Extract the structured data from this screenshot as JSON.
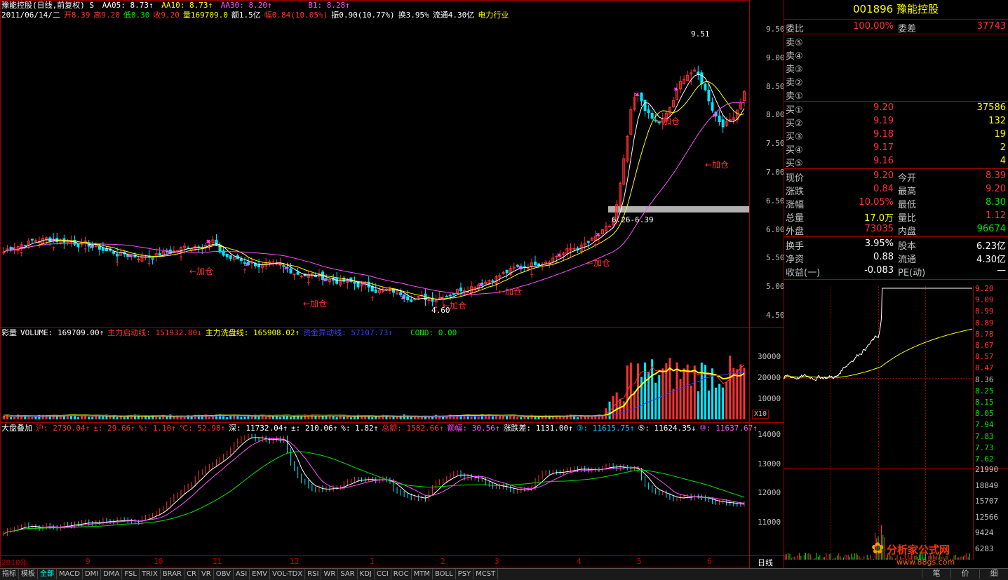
{
  "stock": {
    "code": "001896",
    "name": "豫能控股"
  },
  "top": {
    "line1": [
      "豫能控股(日线,前复权) S",
      "AA05: 8.73↑",
      "AA10: 8.73↑",
      "AA30: 8.20↑",
      "B1: 8.28↑"
    ],
    "line2_date": "2011/06/14/二",
    "line2_open": "开8.39",
    "line2_high": "高9.20",
    "line2_low": "低8.30",
    "line2_close": "收9.20",
    "line2_vol": "量169709.0",
    "line2_amt": "额1.5亿",
    "line2_chg": "幅0.84(10.05%)",
    "line2_amp": "振0.90(10.77%)",
    "line2_turn": "换3.95%",
    "line2_float": "流通4.30亿",
    "line2_ind": "电力行业"
  },
  "main_axis": [
    "9.50",
    "9.00",
    "8.50",
    "8.00",
    "7.50",
    "7.00",
    "6.50",
    "6.00",
    "5.50",
    "5.00",
    "4.50"
  ],
  "annotations": {
    "high_label": "9.51",
    "low_label": "4.60",
    "gap_label": "6.26-6.39",
    "add": "←加仓",
    "add_r": "加仓"
  },
  "vol_header": {
    "label": "彩量",
    "vol": "VOLUME: 169709.00↑",
    "l1": "主力启动线: 151932.80↓",
    "l2": "主力洗盘线: 165908.02↑",
    "l3": "资金异动线: 57107.73↑",
    "cond": "COND: 0.00"
  },
  "vol_axis": [
    "30000",
    "20000",
    "10000"
  ],
  "vol_unit": "X10",
  "idx_header": {
    "label": "大盘叠加",
    "sh": "沪: 2730.04↑",
    "d1": "±: 29.66↑",
    "p1": "%: 1.10↑",
    "t": "℃: 52.98↑",
    "sz": "深: 11732.04↑",
    "d2": "±: 210.06↑",
    "p2": "%: 1.82↑",
    "amt": "总额: 1582.66↑",
    "amp": "额幅: 30.56↑",
    "adv": "涨跌差: 1131.00↑",
    "m1": "③: 11615.75↑",
    "m2": "⑤: 11624.35↓",
    "m3": "⑩: 11637.67↑"
  },
  "idx_axis": [
    "14000",
    "13000",
    "12000",
    "11000"
  ],
  "time_axis": [
    "2010年",
    "9",
    "10",
    "11",
    "12",
    "1",
    "2",
    "3",
    "4",
    "5",
    "6"
  ],
  "period_label": "日线",
  "quote": {
    "weibi": {
      "l": "委比",
      "v": "100.00%",
      "l2": "委差",
      "v2": "37743"
    },
    "sell": [
      {
        "l": "卖⑤"
      },
      {
        "l": "卖④"
      },
      {
        "l": "卖③"
      },
      {
        "l": "卖②"
      },
      {
        "l": "卖①"
      }
    ],
    "buy": [
      {
        "l": "买①",
        "p": "9.20",
        "q": "37586"
      },
      {
        "l": "买②",
        "p": "9.19",
        "q": "132"
      },
      {
        "l": "买③",
        "p": "9.18",
        "q": "19"
      },
      {
        "l": "买④",
        "p": "9.17",
        "q": "2"
      },
      {
        "l": "买⑤",
        "p": "9.16",
        "q": "4"
      }
    ],
    "stats": [
      {
        "l": "现价",
        "v": "9.20",
        "l2": "今开",
        "v2": "8.39"
      },
      {
        "l": "涨跌",
        "v": "0.84",
        "l2": "最高",
        "v2": "9.20"
      },
      {
        "l": "涨幅",
        "v": "10.05%",
        "l2": "最低",
        "v2": "8.30"
      },
      {
        "l": "总量",
        "v": "17.0万",
        "l2": "量比",
        "v2": "1.12"
      },
      {
        "l": "外盘",
        "v": "73035",
        "l2": "内盘",
        "v2": "96674"
      }
    ],
    "fin": [
      {
        "l": "换手",
        "v": "3.95%",
        "l2": "股本",
        "v2": "6.23亿"
      },
      {
        "l": "净资",
        "v": "0.88",
        "l2": "流通",
        "v2": "4.30亿"
      },
      {
        "l": "收益(一)",
        "v": "-0.083",
        "l2": "PE(动)",
        "v2": "—"
      }
    ]
  },
  "minute_axis": [
    "9.20",
    "9.09",
    "8.99",
    "8.89",
    "8.78",
    "8.67",
    "8.57",
    "8.47",
    "8.36",
    "8.25",
    "8.15",
    "8.05",
    "7.94",
    "7.83",
    "7.73",
    "7.62"
  ],
  "minute_vol_axis": [
    "21990",
    "18849",
    "15707",
    "12566",
    "9424",
    "6283"
  ],
  "tabs": [
    "指标",
    "模板",
    "全部",
    "MACD",
    "DMI",
    "DMA",
    "FSL",
    "TRIX",
    "BRAR",
    "CR",
    "VR",
    "OBV",
    "ASI",
    "EMV",
    "VOL-TDX",
    "RSI",
    "WR",
    "SAR",
    "KDJ",
    "CCI",
    "ROC",
    "MTM",
    "BOLL",
    "PSY",
    "MCST"
  ],
  "selected_tab": "全部",
  "right_tabs": [
    "笔",
    "价",
    "细"
  ],
  "watermark": {
    "cn": "分析家公式网",
    "url": "www.88gs.com"
  },
  "colors": {
    "up": "#ff3232",
    "down": "#00e6ff",
    "ma5": "#ffffff",
    "ma10": "#ffff00",
    "ma30": "#ff50ff",
    "frame": "#a00000"
  }
}
